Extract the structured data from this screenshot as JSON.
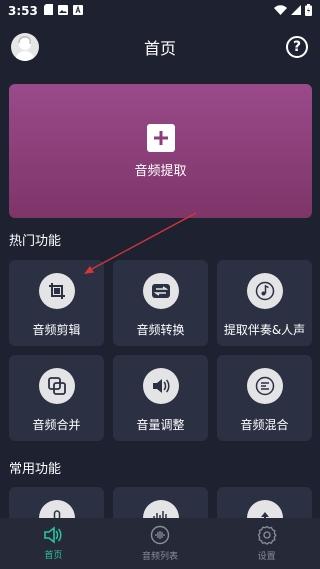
{
  "status_bar": {
    "time": "3:53"
  },
  "header": {
    "title": "首页"
  },
  "hero": {
    "label": "音频提取"
  },
  "hot_section": {
    "title": "热门功能",
    "items": [
      {
        "label": "音频剪辑",
        "icon": "crop-icon"
      },
      {
        "label": "音频转换",
        "icon": "swap-arrows-icon"
      },
      {
        "label": "提取伴奏&人声",
        "icon": "music-note-icon"
      },
      {
        "label": "音频合并",
        "icon": "merge-icon"
      },
      {
        "label": "音量调整",
        "icon": "volume-icon"
      },
      {
        "label": "音频混合",
        "icon": "mix-icon"
      }
    ]
  },
  "common_section": {
    "title": "常用功能"
  },
  "bottom_nav": {
    "items": [
      {
        "label": "首页",
        "icon": "home-speaker-icon",
        "active": true
      },
      {
        "label": "音频列表",
        "icon": "waveform-list-icon",
        "active": false
      },
      {
        "label": "设置",
        "icon": "gear-icon",
        "active": false
      }
    ]
  },
  "colors": {
    "background": "#1e2230",
    "card": "#2b3042",
    "hero_top": "#9a4a8a",
    "hero_bottom": "#7e3568",
    "accent": "#29c4a0",
    "arrow": "#d9343a"
  }
}
